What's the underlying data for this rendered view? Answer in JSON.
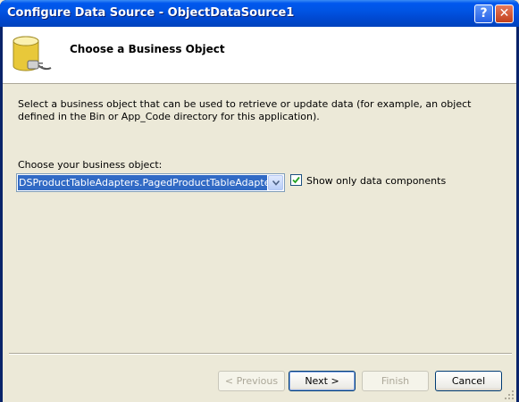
{
  "window": {
    "title": "Configure Data Source - ObjectDataSource1",
    "help_glyph": "?",
    "close_glyph": "✕"
  },
  "header": {
    "title": "Choose a Business Object",
    "icon": "database-plug-icon"
  },
  "body": {
    "description": "Select a business object that can be used to retrieve or update data (for example, an object defined in the Bin or App_Code directory for this application).",
    "choose_label": "Choose your business object:",
    "business_object": {
      "selected": "DSProductTableAdapters.PagedProductTableAdapter"
    },
    "show_only_data_components": {
      "label": "Show only data components",
      "checked": true
    }
  },
  "buttons": {
    "previous": "< Previous",
    "next": "Next >",
    "finish": "Finish",
    "cancel": "Cancel"
  },
  "colors": {
    "titlebar": "#0054E3",
    "selection": "#316AC5",
    "dialog_bg": "#ECE9D8"
  }
}
